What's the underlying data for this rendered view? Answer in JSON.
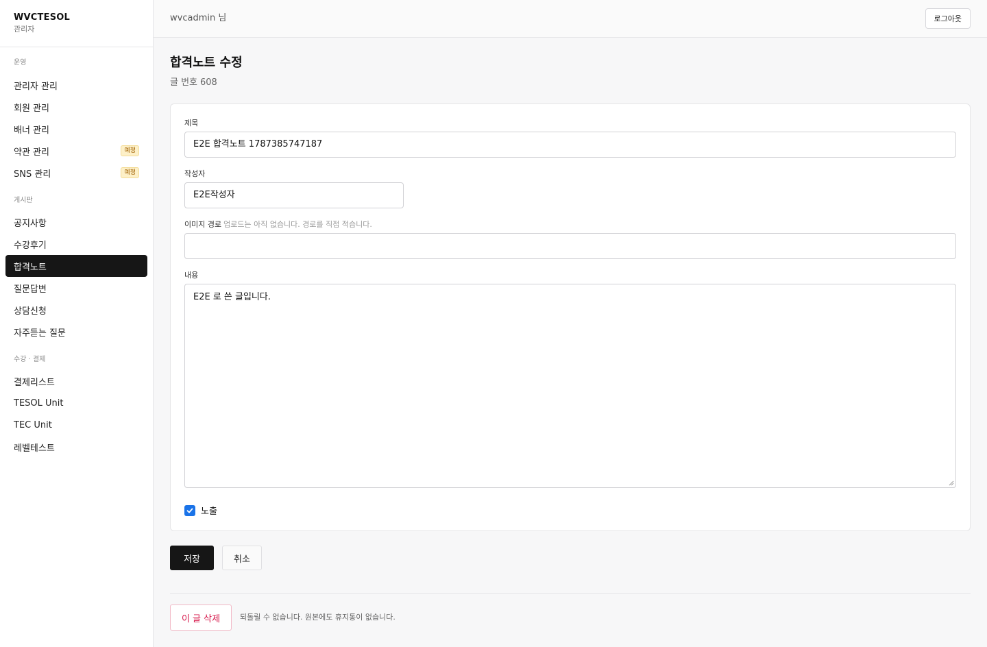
{
  "brand": {
    "title": "WVCTESOL",
    "subtitle": "관리자"
  },
  "sidebar": {
    "sections": [
      {
        "title": "운영",
        "items": [
          {
            "label": "관리자 관리",
            "badge": ""
          },
          {
            "label": "회원 관리",
            "badge": ""
          },
          {
            "label": "배너 관리",
            "badge": ""
          },
          {
            "label": "약관 관리",
            "badge": "예정"
          },
          {
            "label": "SNS 관리",
            "badge": "예정"
          }
        ]
      },
      {
        "title": "게시판",
        "items": [
          {
            "label": "공지사항",
            "badge": ""
          },
          {
            "label": "수강후기",
            "badge": ""
          },
          {
            "label": "합격노트",
            "badge": "",
            "active": true
          },
          {
            "label": "질문답변",
            "badge": ""
          },
          {
            "label": "상담신청",
            "badge": ""
          },
          {
            "label": "자주듣는 질문",
            "badge": ""
          }
        ]
      },
      {
        "title": "수강 · 결제",
        "items": [
          {
            "label": "결제리스트",
            "badge": ""
          },
          {
            "label": "TESOL Unit",
            "badge": ""
          },
          {
            "label": "TEC Unit",
            "badge": ""
          },
          {
            "label": "레벨테스트",
            "badge": ""
          }
        ]
      }
    ]
  },
  "header": {
    "user": "wvcadmin 님",
    "logout_label": "로그아웃"
  },
  "page": {
    "title": "합격노트 수정",
    "post_label": "글 번호",
    "post_number": "608"
  },
  "form": {
    "title_label": "제목",
    "title_value": "E2E 합격노트 1787385747187",
    "author_label": "작성자",
    "author_value": "E2E작성자",
    "image_label": "이미지 경로",
    "image_hint": "업로드는 아직 없습니다. 경로를 직접 적습니다.",
    "image_value": "",
    "content_label": "내용",
    "content_value": "E2E 로 쓴 글입니다.",
    "visible_label": "노출",
    "visible_checked": true
  },
  "actions": {
    "save_label": "저장",
    "cancel_label": "취소",
    "delete_label": "이 글 삭제",
    "delete_note": "되돌릴 수 없습니다. 원본에도 휴지통이 없습니다."
  },
  "colors": {
    "accent": "#161616",
    "checkbox": "#1a73e8",
    "danger": "#d6174a",
    "badge_bg": "#fdf0c8"
  }
}
